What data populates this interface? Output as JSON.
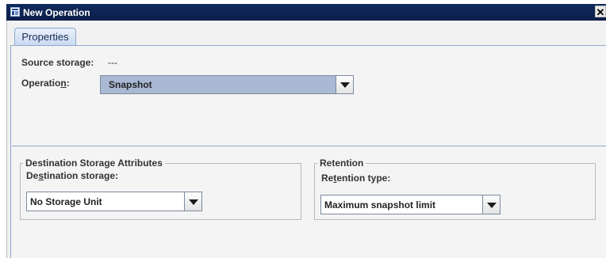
{
  "window": {
    "title": "New Operation",
    "close_label": "✕"
  },
  "tabs": [
    {
      "label": "Properties"
    }
  ],
  "source_storage": {
    "label": "Source storage:",
    "value": "---"
  },
  "operation": {
    "label_prefix": "Operatio",
    "label_mnemonic": "n",
    "label_suffix": ":",
    "value": "Snapshot"
  },
  "destination_group": {
    "title": "Destination Storage Attributes",
    "field_label_prefix": "De",
    "field_label_mnemonic": "s",
    "field_label_suffix": "tination storage:",
    "value": "No Storage Unit"
  },
  "retention_group": {
    "title": "Retention",
    "field_label_prefix": "Re",
    "field_label_mnemonic": "t",
    "field_label_suffix": "ention type:",
    "value": "Maximum snapshot limit"
  },
  "icons": {
    "app": "window-icon",
    "dropdown": "dropdown-arrow-icon",
    "close": "close-icon"
  },
  "colors": {
    "titlebar": "#0f2a5e",
    "selected_combo": "#a9b8d3",
    "accent_border": "#8fa8cc"
  }
}
